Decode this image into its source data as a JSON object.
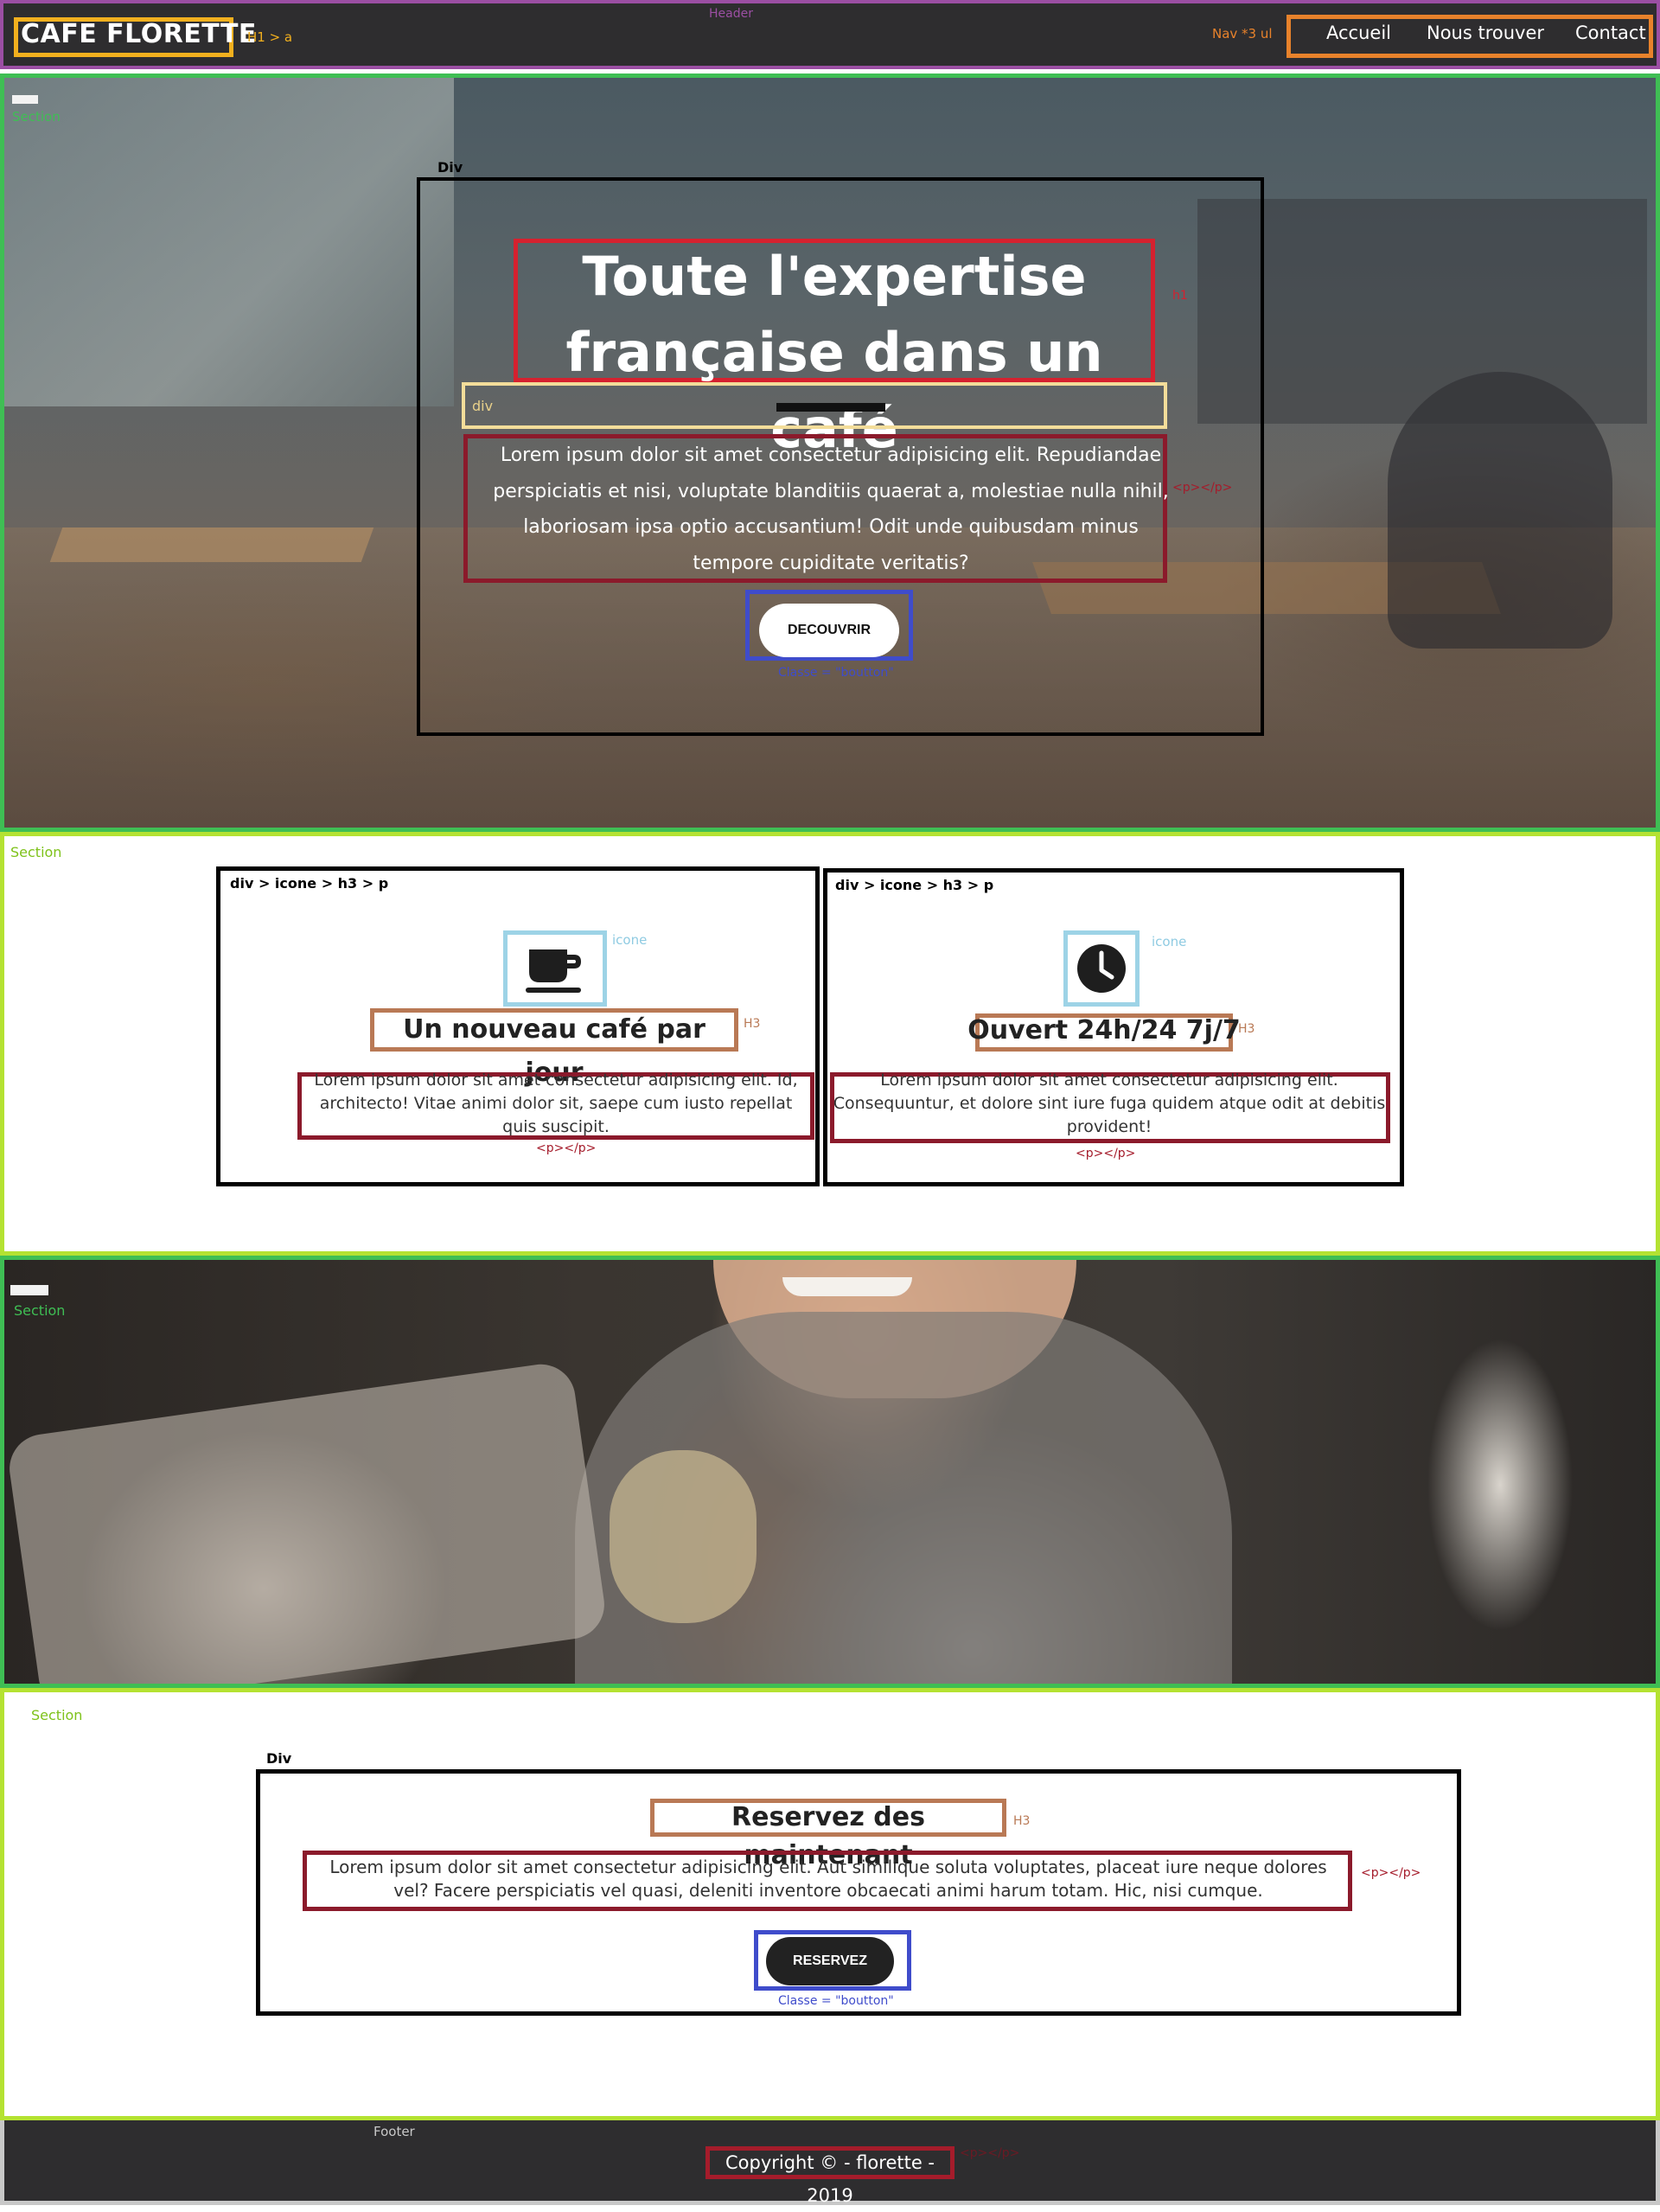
{
  "header": {
    "label": "Header",
    "logo": "CAFE FLORETTE",
    "logo_note": "H1 > a",
    "nav_note": "Nav *3 ul",
    "nav_items": [
      "Accueil",
      "Nous trouver",
      "Contact"
    ]
  },
  "hero": {
    "section_label": "Section",
    "div_label": "Div",
    "title": "Toute l'expertise française dans un café",
    "title_note": "h1",
    "divider_label": "div",
    "paragraph": "Lorem ipsum dolor sit amet consectetur adipisicing elit. Repudiandae perspiciatis et nisi, voluptate blanditiis quaerat a, molestiae nulla nihil, laboriosam ipsa optio accusantium! Odit unde quibusdam minus tempore cupiditate veritatis?",
    "paragraph_note": "<p></p>",
    "cta_label": "DECOUVRIR",
    "cta_note": "Classe = \"boutton\""
  },
  "features": {
    "section_label": "Section",
    "cards": [
      {
        "structure_label": "div > icone > h3 > p",
        "icon": "coffee-cup-icon",
        "icon_note": "icone",
        "title": "Un nouveau café par jour",
        "title_note": "H3",
        "text": "Lorem ipsum dolor sit amet consectetur adipisicing elit. Id, architecto! Vitae animi dolor sit, saepe cum iusto repellat quis suscipit.",
        "text_note": "<p></p>"
      },
      {
        "structure_label": "div > icone > h3 > p",
        "icon": "clock-icon",
        "icon_note": "icone",
        "title": "Ouvert 24h/24 7j/7",
        "title_note": "H3",
        "text": "Lorem ipsum dolor sit amet consectetur adipisicing elit. Consequuntur, et dolore sint iure fuga quidem atque odit at debitis provident!",
        "text_note": "<p></p>"
      }
    ]
  },
  "photo": {
    "section_label": "Section"
  },
  "reservation": {
    "section_label": "Section",
    "div_label": "Div",
    "title": "Reservez des maintenant",
    "title_note": "H3",
    "text": "Lorem ipsum dolor sit amet consectetur adipisicing elit. Aut similique soluta voluptates, placeat iure neque dolores vel? Facere perspiciatis vel quasi, deleniti inventore obcaecati animi harum totam. Hic, nisi cumque.",
    "text_note": "<p></p>",
    "button_label": "RESERVEZ",
    "button_note": "Classe = \"boutton\""
  },
  "footer": {
    "label": "Footer",
    "copyright": "Copyright © - florette - 2019",
    "copyright_note": "<p></p>"
  },
  "colors": {
    "header_bg": "#2e2d2f",
    "header_outline": "#9b4fa3",
    "logo_outline": "#f2b01e",
    "nav_outline": "#e8822b",
    "section_outline_green": "#3fbe54",
    "section_outline_lime": "#b4e232",
    "heading_outline": "#d5212f",
    "paragraph_outline": "#8b1a2b",
    "button_outline": "#3f4ccb",
    "icon_outline": "#9dd3e6",
    "h3_outline": "#b97955"
  }
}
